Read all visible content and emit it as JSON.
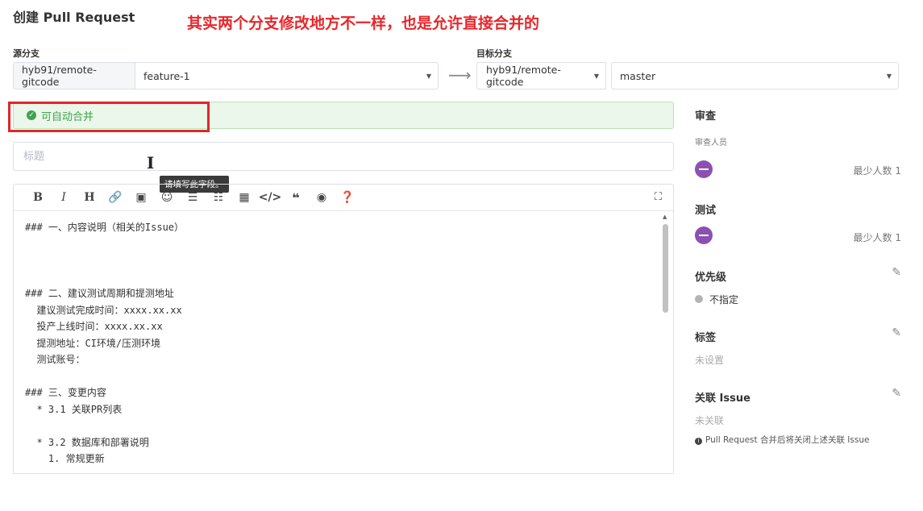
{
  "header": {
    "title": "创建 Pull Request",
    "annotation": "其实两个分支修改地方不一样，也是允许直接合并的"
  },
  "source": {
    "label": "源分支",
    "repo": "hyb91/remote-gitcode",
    "branch": "feature-1"
  },
  "target": {
    "label": "目标分支",
    "repo": "hyb91/remote-gitcode",
    "branch": "master"
  },
  "merge_status": {
    "text": "可自动合并",
    "color": "#3fa34d"
  },
  "title_field": {
    "placeholder": "标题",
    "tooltip": "请填写此字段。"
  },
  "editor": {
    "toolbar": [
      "bold-icon",
      "italic-icon",
      "heading-icon",
      "link-icon",
      "image-icon",
      "emoji-icon",
      "bullet-list-icon",
      "numbered-list-icon",
      "table-icon",
      "code-icon",
      "quote-icon",
      "preview-icon",
      "help-icon",
      "fullscreen-icon"
    ],
    "content": "### 一、内容说明（相关的Issue）\n\n\n\n### 二、建议测试周期和提测地址\n  建议测试完成时间：xxxx.xx.xx\n  投产上线时间：xxxx.xx.xx\n  提测地址：CI环境/压测环境\n  测试账号：\n\n### 三、变更内容\n  * 3.1 关联PR列表\n\n  * 3.2 数据库和部署说明\n    1. 常规更新"
  },
  "sidebar": {
    "review": {
      "title": "审查",
      "subtitle": "审查人员",
      "min_count": "最少人数 1"
    },
    "test": {
      "title": "测试",
      "min_count": "最少人数 1"
    },
    "priority": {
      "title": "优先级",
      "value": "不指定"
    },
    "labels": {
      "title": "标签",
      "value": "未设置"
    },
    "issue": {
      "title": "关联 Issue",
      "value": "未关联",
      "note": "Pull Request 合并后将关闭上述关联 Issue"
    }
  },
  "colors": {
    "accent_red": "#e8262a",
    "avatar": "#8b51b1"
  }
}
